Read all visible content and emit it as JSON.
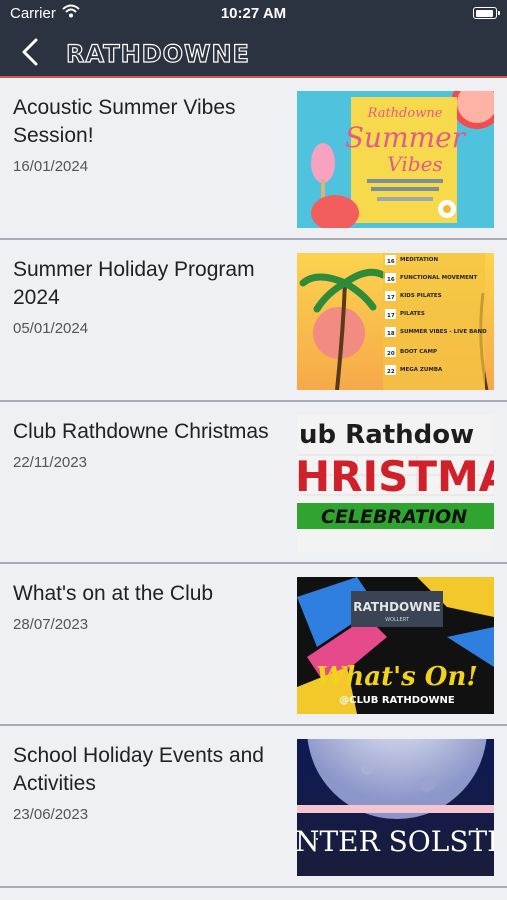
{
  "status": {
    "carrier": "Carrier",
    "time": "10:27 AM"
  },
  "nav": {
    "title": "RATHDOWNE"
  },
  "items": [
    {
      "title": "Acoustic Summer Vibes Session!",
      "date": "16/01/2024",
      "thumb": {
        "line1": "Rathdowne",
        "line2": "Summer",
        "line3": "Vibes"
      }
    },
    {
      "title": "Summer Holiday Program 2024",
      "date": "05/01/2024",
      "thumb": {
        "rows": [
          {
            "day": "16",
            "label": "MEDITATION"
          },
          {
            "day": "16",
            "label": "FUNCTIONAL MOVEMENT"
          },
          {
            "day": "17",
            "label": "KIDS PILATES"
          },
          {
            "day": "17",
            "label": "PILATES"
          },
          {
            "day": "18",
            "label": "SUMMER VIBES - LIVE BAND"
          },
          {
            "day": "20",
            "label": "BOOT CAMP"
          },
          {
            "day": "22",
            "label": "MEGA ZUMBA"
          }
        ]
      }
    },
    {
      "title": "Club Rathdowne Christmas",
      "date": "22/11/2023",
      "thumb": {
        "line1": "ub Rathdow",
        "line2": "HRISTMA",
        "line3": "CELEBRATION"
      }
    },
    {
      "title": "What's on at the Club",
      "date": "28/07/2023",
      "thumb": {
        "line1": "RATHDOWNE",
        "line2": "WOLLERT",
        "line3": "What's On!",
        "line4": "@CLUB RATHDOWNE"
      }
    },
    {
      "title": "School Holiday Events and Activities",
      "date": "23/06/2023",
      "thumb": {
        "line1": "NTER SOLSTI"
      }
    }
  ]
}
